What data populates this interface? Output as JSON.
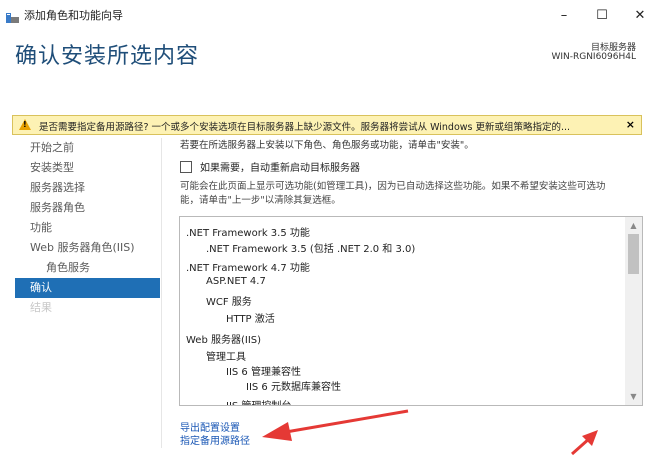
{
  "window": {
    "title": "添加角色和功能向导",
    "controls": {
      "minimize": "–",
      "maximize": "☐",
      "close": "✕"
    }
  },
  "header": {
    "page_title": "确认安装所选内容",
    "destination_label": "目标服务器",
    "destination_server": "WIN-RGNI6096H4L"
  },
  "warning": {
    "text": "是否需要指定备用源路径? 一个或多个安装选项在目标服务器上缺少源文件。服务器将尝试从 Windows 更新或组策略指定的...",
    "close": "×"
  },
  "sidebar": {
    "items": [
      {
        "label": "开始之前"
      },
      {
        "label": "安装类型"
      },
      {
        "label": "服务器选择"
      },
      {
        "label": "服务器角色"
      },
      {
        "label": "功能"
      },
      {
        "label": "Web 服务器角色(IIS)"
      },
      {
        "label": "角色服务"
      },
      {
        "label": "确认"
      },
      {
        "label": "结果"
      }
    ]
  },
  "main": {
    "intro": "若要在所选服务器上安装以下角色、角色服务或功能，请单击\"安装\"。",
    "restart_checkbox_label": "如果需要，自动重新启动目标服务器",
    "note_line1": "可能会在此页面上显示可选功能(如管理工具)，因为已自动选择这些功能。如果不希望安装这些可选功",
    "note_line2": "能，请单击\"上一步\"以清除其复选框。",
    "list_items": [
      ".NET Framework 3.5 功能",
      ".NET Framework 3.5 (包括 .NET 2.0 和 3.0)",
      ".NET Framework 4.7 功能",
      "ASP.NET 4.7",
      "WCF 服务",
      "HTTP 激活",
      "Web 服务器(IIS)",
      "管理工具",
      "IIS 6 管理兼容性",
      "IIS 6 元数据库兼容性",
      "IIS 管理控制台"
    ],
    "export_link": "导出配置设置",
    "alt_source_link": "指定备用源路径"
  },
  "colors": {
    "accent": "#1f6fb5",
    "title": "#1f4e79",
    "warning_bg": "#fdf2b4",
    "link": "#1a57b5",
    "arrow": "#e53935"
  }
}
